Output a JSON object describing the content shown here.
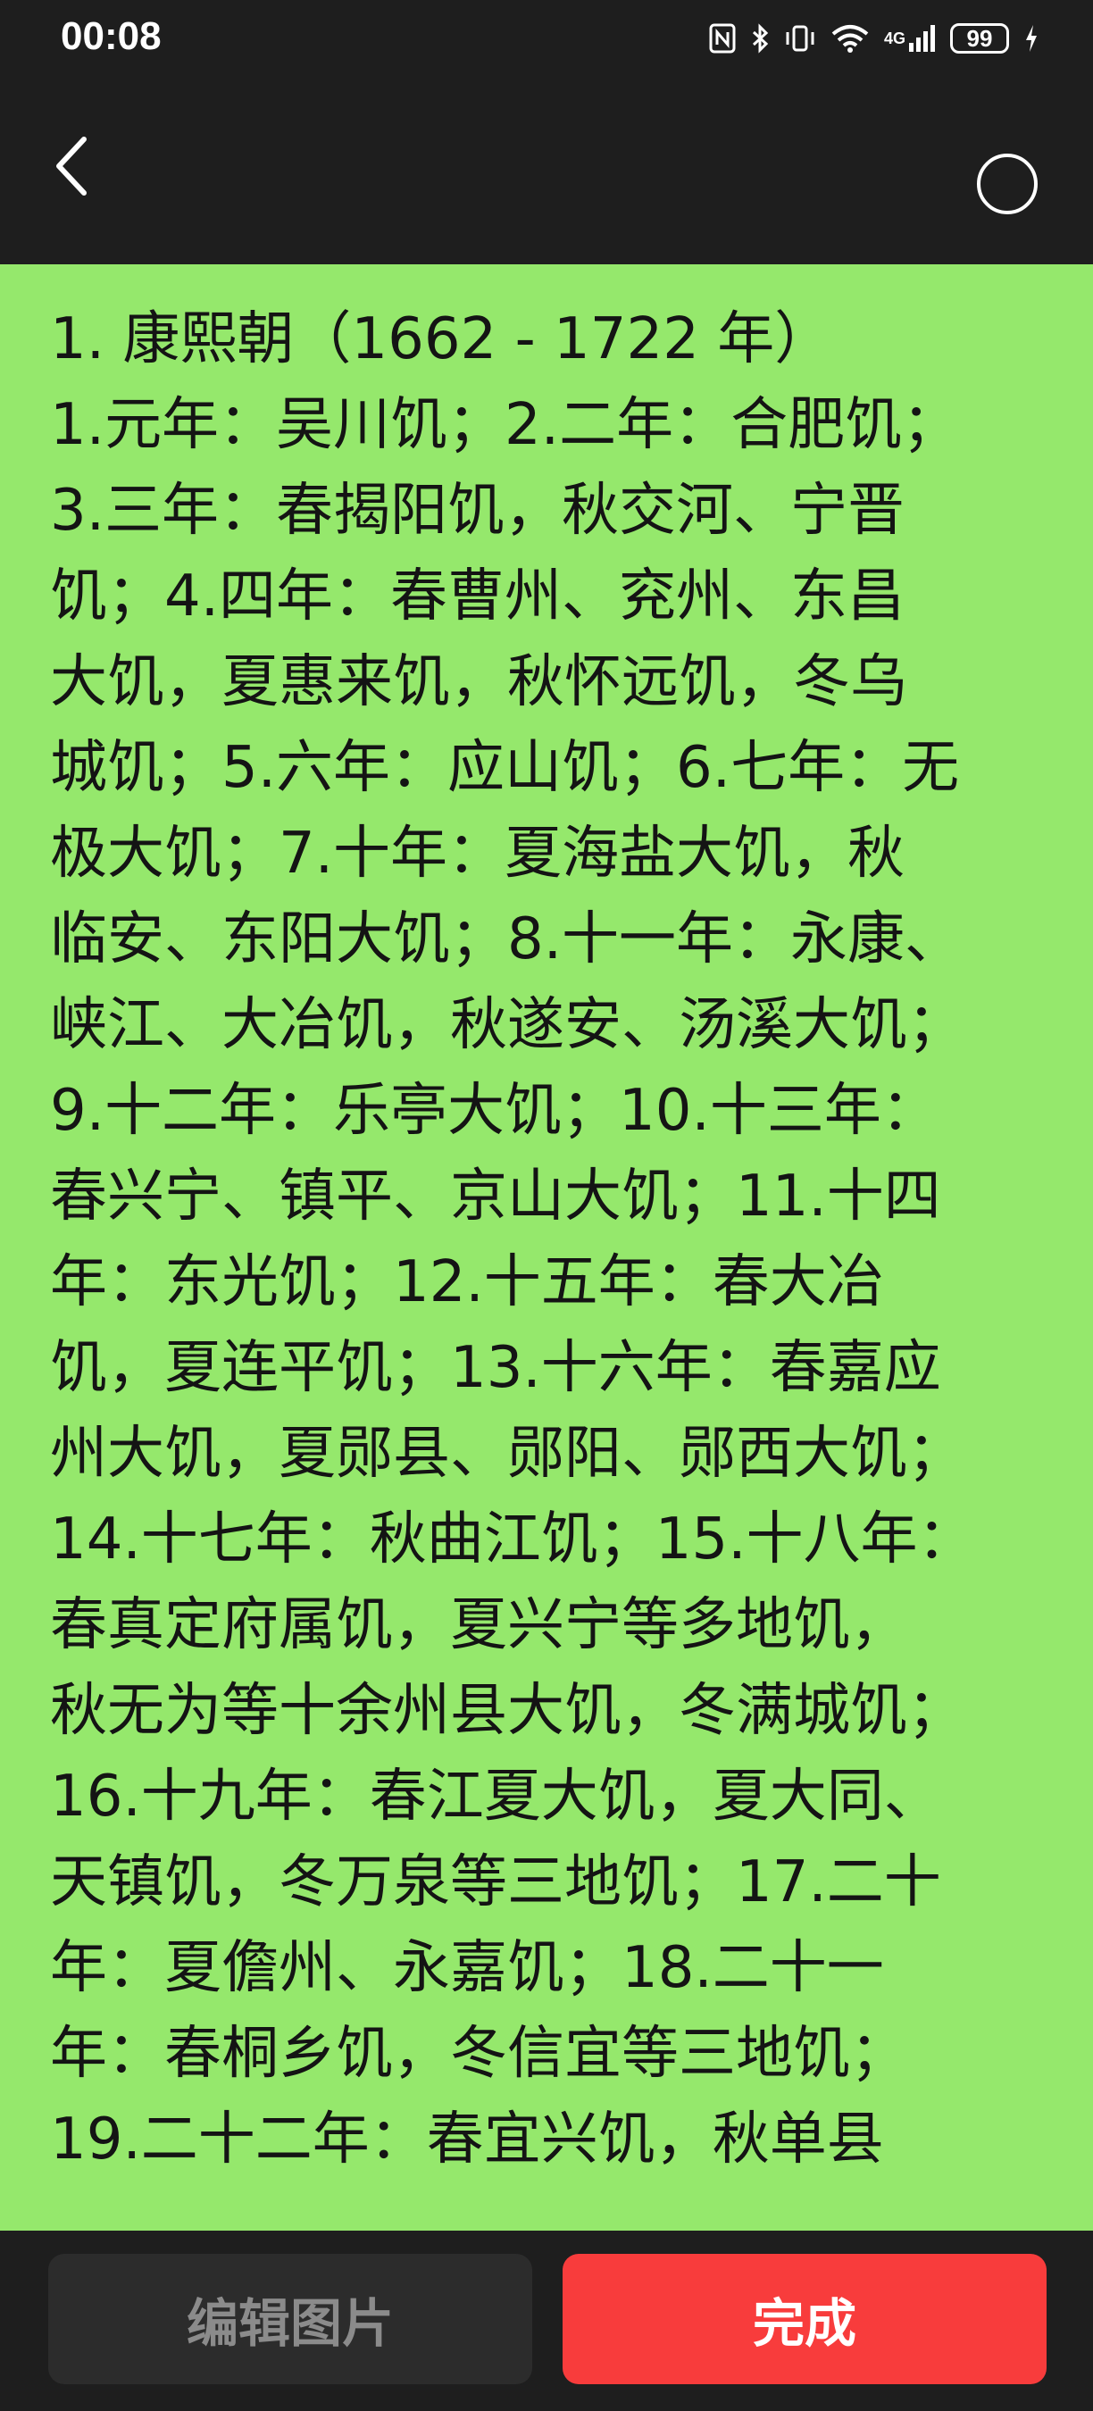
{
  "status_bar": {
    "time": "00:08",
    "battery": "99",
    "icons": [
      "nfc-icon",
      "bluetooth-icon",
      "vibrate-icon",
      "wifi-icon",
      "signal-4g-icon",
      "battery-icon",
      "charging-icon"
    ],
    "network_label": "4G"
  },
  "header": {
    "back_icon": "chevron-left-icon",
    "select_icon": "circle-select-icon"
  },
  "image_text": {
    "lines": [
      "1. 康熙朝（1662 - 1722 年）",
      "1.元年：吴川饥；2.二年：合肥饥；",
      "3.三年：春揭阳饥，秋交河、宁晋",
      "饥；4.四年：春曹州、兖州、东昌",
      "大饥，夏惠来饥，秋怀远饥，冬乌",
      "城饥；5.六年：应山饥；6.七年：无",
      "极大饥；7.十年：夏海盐大饥，秋",
      "临安、东阳大饥；8.十一年：永康、",
      "峡江、大冶饥，秋遂安、汤溪大饥；",
      "9.十二年：乐亭大饥；10.十三年：",
      "春兴宁、镇平、京山大饥；11.十四",
      "年：东光饥；12.十五年：春大冶",
      "饥，夏连平饥；13.十六年：春嘉应",
      "州大饥，夏郧县、郧阳、郧西大饥；",
      "14.十七年：秋曲江饥；15.十八年：",
      "春真定府属饥，夏兴宁等多地饥，",
      "秋无为等十余州县大饥，冬满城饥；",
      "16.十九年：春江夏大饥，夏大同、",
      "天镇饥，冬万泉等三地饥；17.二十",
      "年：夏儋州、永嘉饥；18.二十一",
      "年：春桐乡饥，冬信宜等三地饥；",
      "19.二十二年：春宜兴饥，秋单县"
    ]
  },
  "actions": {
    "edit_label": "编辑图片",
    "done_label": "完成"
  },
  "colors": {
    "background": "#1e1e1e",
    "image_background": "#95e86c",
    "done_button": "#f83c3c",
    "edit_button": "#2c2c2c"
  }
}
